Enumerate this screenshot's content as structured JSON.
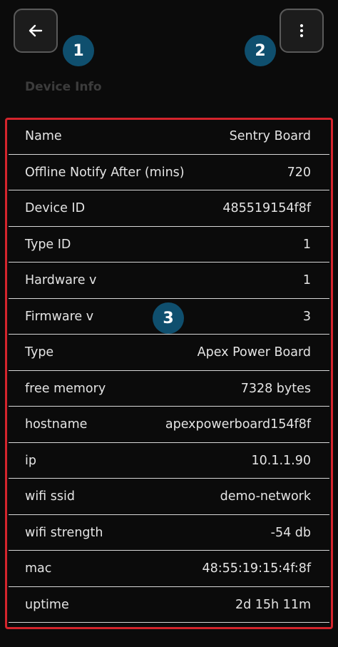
{
  "header": {
    "back_icon": "arrow-left-icon",
    "more_icon": "more-vertical-icon",
    "title": "Device Info"
  },
  "badges": [
    "1",
    "2",
    "3"
  ],
  "colors": {
    "background": "#0b0b0b",
    "badge": "#0f4f6e",
    "highlight_border": "#d4242c",
    "divider": "#d8d8d8"
  },
  "rows": [
    {
      "label": "Name",
      "value": "Sentry Board"
    },
    {
      "label": "Offline Notify After (mins)",
      "value": "720"
    },
    {
      "label": "Device ID",
      "value": "485519154f8f"
    },
    {
      "label": "Type ID",
      "value": "1"
    },
    {
      "label": "Hardware v",
      "value": "1"
    },
    {
      "label": "Firmware v",
      "value": "3"
    },
    {
      "label": "Type",
      "value": "Apex Power Board"
    },
    {
      "label": "free memory",
      "value": "7328 bytes"
    },
    {
      "label": "hostname",
      "value": "apexpowerboard154f8f"
    },
    {
      "label": "ip",
      "value": "10.1.1.90"
    },
    {
      "label": "wifi ssid",
      "value": "demo-network"
    },
    {
      "label": "wifi strength",
      "value": "-54 db"
    },
    {
      "label": "mac",
      "value": "48:55:19:15:4f:8f"
    },
    {
      "label": "uptime",
      "value": "2d 15h 11m"
    }
  ]
}
